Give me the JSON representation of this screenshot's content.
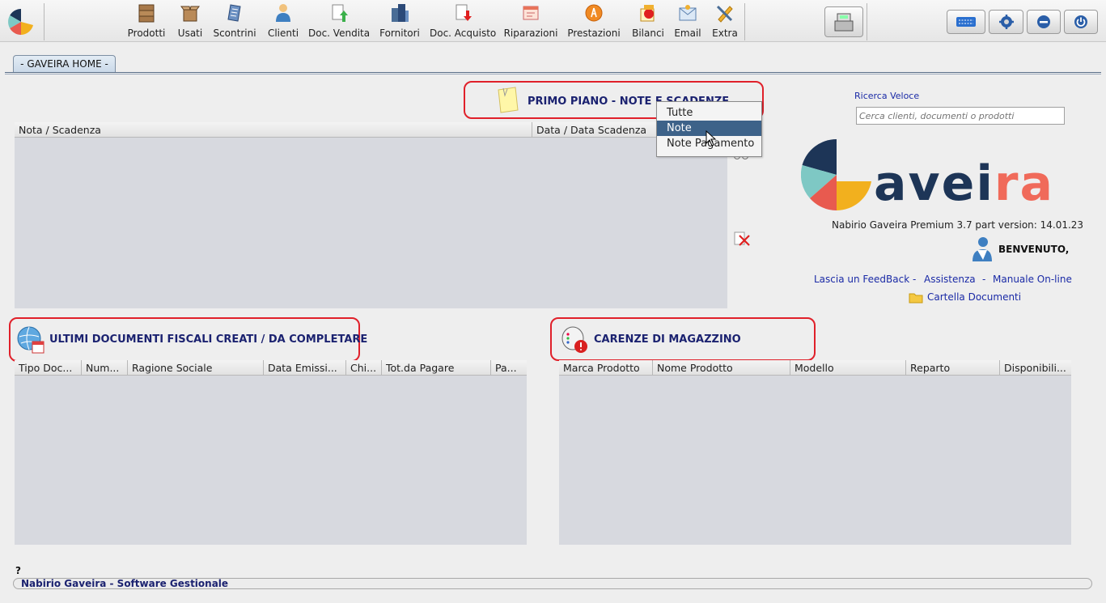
{
  "toolbar": {
    "items": [
      {
        "label": "Prodotti",
        "icon": "boxes-icon"
      },
      {
        "label": "Usati",
        "icon": "open-box-icon"
      },
      {
        "label": "Scontrini",
        "icon": "receipt-icon"
      },
      {
        "label": "Clienti",
        "icon": "customer-icon"
      },
      {
        "label": "Doc. Vendita",
        "icon": "sales-doc-icon"
      },
      {
        "label": "Fornitori",
        "icon": "suppliers-icon"
      },
      {
        "label": "Doc. Acquisto",
        "icon": "purchase-doc-icon"
      },
      {
        "label": "Riparazioni",
        "icon": "repair-icon"
      },
      {
        "label": "Prestazioni",
        "icon": "services-icon"
      },
      {
        "label": "Bilanci",
        "icon": "balance-icon"
      },
      {
        "label": "Email",
        "icon": "email-icon"
      },
      {
        "label": "Extra",
        "icon": "tools-icon"
      }
    ]
  },
  "tab": {
    "label": "- GAVEIRA HOME -"
  },
  "notes": {
    "title": "PRIMO PIANO  -  NOTE E SCADENZE",
    "columns": [
      "Nota / Scadenza",
      "Data / Data Scadenza"
    ]
  },
  "dropdown": {
    "options": [
      "Tutte",
      "Note",
      "Note Pagamento"
    ],
    "selected": "Note"
  },
  "search": {
    "label": "Ricerca Veloce",
    "placeholder": "Cerca clienti, documenti o prodotti"
  },
  "brand": {
    "name": "aveira",
    "version": "Nabirio Gaveira Premium 3.7 part version: 14.01.23",
    "welcome": "BENVENUTO,"
  },
  "links": {
    "feedback": "Lascia un FeedBack",
    "sep1": "-",
    "assistance": "Assistenza",
    "sep2": "-",
    "manual": "Manuale On-line",
    "folder": "Cartella Documenti"
  },
  "documents": {
    "title": "ULTIMI DOCUMENTI FISCALI CREATI / DA COMPLETARE",
    "columns": [
      "Tipo Doc...",
      "Num...",
      "Ragione Sociale",
      "Data Emissi...",
      "Chi...",
      "Tot.da Pagare",
      "Pa..."
    ]
  },
  "stock": {
    "title": "CARENZE DI MAGAZZINO",
    "columns": [
      "Marca Prodotto",
      "Nome Prodotto",
      "Modello",
      "Reparto",
      "Disponibili..."
    ]
  },
  "footer": {
    "help": "?",
    "company": "Nabirio Gaveira - Software Gestionale"
  },
  "colors": {
    "title_blue": "#1b2270",
    "highlight_red": "#e0202a",
    "menu_selected": "#3d6289",
    "brand_navy": "#1d3557",
    "brand_teal": "#7ec8c4",
    "brand_red": "#e85a4f",
    "brand_yellow": "#f2b01e",
    "brand_coral": "#f06a5a"
  }
}
